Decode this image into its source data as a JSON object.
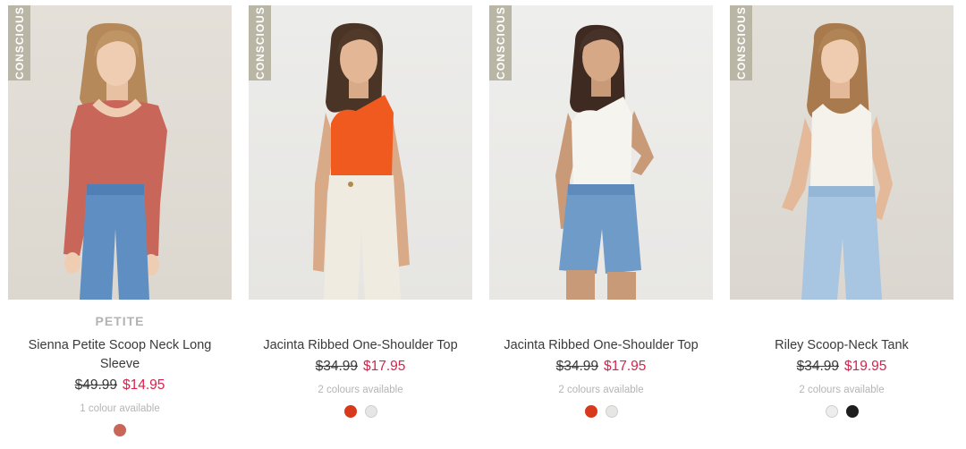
{
  "products": [
    {
      "badge": "CONSCIOUS",
      "sub_brand": "PETITE",
      "title": "Sienna Petite Scoop Neck Long Sleeve",
      "old_price": "$49.99",
      "new_price": "$14.95",
      "availability": "1 colour available",
      "swatches": [
        "#c8665a"
      ]
    },
    {
      "badge": "CONSCIOUS",
      "title": "Jacinta Ribbed One-Shoulder Top",
      "old_price": "$34.99",
      "new_price": "$17.95",
      "availability": "2 colours available",
      "swatches": [
        "#d8381b",
        "#e6e6e4"
      ]
    },
    {
      "badge": "CONSCIOUS",
      "title": "Jacinta Ribbed One-Shoulder Top",
      "old_price": "$34.99",
      "new_price": "$17.95",
      "availability": "2 colours available",
      "swatches": [
        "#d8381b",
        "#e6e6e4"
      ]
    },
    {
      "badge": "CONSCIOUS",
      "title": "Riley Scoop-Neck Tank",
      "old_price": "$34.99",
      "new_price": "$19.95",
      "availability": "2 colours available",
      "swatches": [
        "#ededeb",
        "#1e1e1e"
      ]
    }
  ],
  "colors": {
    "sale_price": "#d6234d",
    "badge_bg": "#b9b6a6"
  }
}
